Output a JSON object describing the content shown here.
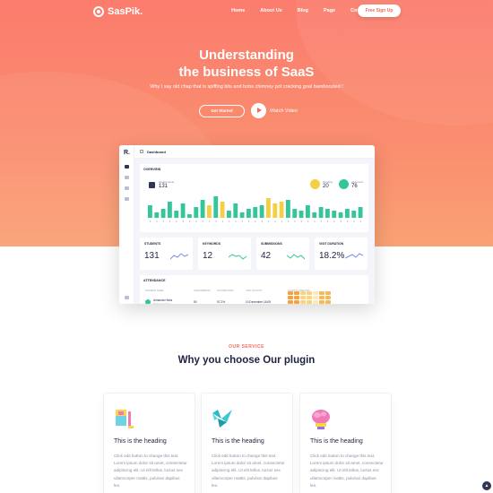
{
  "brand": {
    "name": "SasPik."
  },
  "nav": {
    "items": [
      "Home",
      "About Us",
      "Blog",
      "Page",
      "Contact"
    ],
    "signup_label": "Free Sign Up"
  },
  "hero": {
    "title_line1": "Understanding",
    "title_line2": "the business of SaaS",
    "subtitle": "Why I say old chap that is spiffing bits and bobs chimney pot cracking goal bamboozled !",
    "cta_label": "Get Started",
    "watch_label": "Watch Video"
  },
  "dashboard": {
    "logo": "R.",
    "top_title": "Dashboard",
    "overview": {
      "label": "OVERVIEW",
      "assignments_label": "Assignments",
      "assignments_value": "131",
      "pending_label": "Pending",
      "pending_value": "20",
      "approved_label": "Approved",
      "approved_value": "76"
    },
    "stats": [
      {
        "label": "STUDENTS",
        "value": "131",
        "color": "#7c8cf0"
      },
      {
        "label": "KEYWORDS",
        "value": "12",
        "color": "#34c69a"
      },
      {
        "label": "SUBMISSIONS",
        "value": "42",
        "color": "#34c69a"
      },
      {
        "label": "VISIT DURATION",
        "value": "18.2%",
        "color": "#7c8cf0"
      }
    ],
    "attendance": {
      "label": "ATTENDANCE",
      "headers": [
        "STUDENT NAME",
        "ASSIGNMENTS",
        "ON-TIME RATE",
        "LAST ACTIVITY",
        "ACTIVITY ANALYSIS"
      ],
      "row": {
        "name": "Almanda Hicks",
        "role": "Marketing Head",
        "assignments": "50",
        "rate": "97.2%",
        "last": "10 December 16:09"
      }
    },
    "bar_colors": {
      "green": "#34c69a",
      "yellow": "#f4cf45"
    }
  },
  "services": {
    "kicker": "OUR SERVICE",
    "title": "Why you choose Our plugin",
    "cards": [
      {
        "heading": "This is the heading",
        "text": "Click edit button to change this text. Lorem ipsum dolor sit amet, consectetur adipiscing elit. Ut elit tellus, luctus nec ullamcorper mattis, pulvinar dapibus leo."
      },
      {
        "heading": "This is the heading",
        "text": "Click edit button to change this text. Lorem ipsum dolor sit amet, consectetur adipiscing elit. Ut elit tellus, luctus nec ullamcorper mattis, pulvinar dapibus leo."
      },
      {
        "heading": "This is the heading",
        "text": "Click edit button to change this text. Lorem ipsum dolor sit amet, consectetur adipiscing elit. Ut elit tellus, luctus nec ullamcorper mattis, pulvinar dapibus leo."
      }
    ]
  },
  "colors": {
    "accent": "#f66b5d",
    "dark": "#1f2340"
  }
}
